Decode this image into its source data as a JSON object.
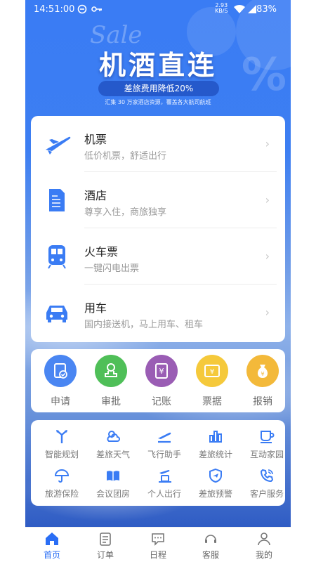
{
  "status_bar": {
    "time": "14:51:00",
    "net_speed_value": "2.93",
    "net_speed_unit": "KB/S",
    "battery": "83%"
  },
  "banner": {
    "sale_word": "Sale",
    "title": "机酒直连",
    "pill": "差旅费用降低20%",
    "subtitle": "汇集 30 万家酒店资源，覆盖各大航司航班",
    "percent_glyph": "%"
  },
  "services": [
    {
      "title": "机票",
      "desc": "低价机票，舒适出行",
      "icon": "airplane-icon"
    },
    {
      "title": "酒店",
      "desc": "尊享入住，商旅独享",
      "icon": "hotel-icon"
    },
    {
      "title": "火车票",
      "desc": "一键闪电出票",
      "icon": "train-icon"
    },
    {
      "title": "用车",
      "desc": "国内接送机，马上用车、租车",
      "icon": "car-icon"
    }
  ],
  "tools": [
    {
      "label": "申请",
      "color": "#4a86f2",
      "icon": "application-icon"
    },
    {
      "label": "审批",
      "color": "#4fbf58",
      "icon": "approval-icon"
    },
    {
      "label": "记账",
      "color": "#9a5db4",
      "icon": "bookkeeping-icon"
    },
    {
      "label": "票据",
      "color": "#f5c93b",
      "icon": "receipt-icon"
    },
    {
      "label": "报销",
      "color": "#f3b93a",
      "icon": "reimbursement-icon"
    }
  ],
  "grid": [
    {
      "label": "智能规划",
      "icon": "route-icon"
    },
    {
      "label": "差旅天气",
      "icon": "weather-icon"
    },
    {
      "label": "飞行助手",
      "icon": "takeoff-icon"
    },
    {
      "label": "差旅统计",
      "icon": "statistics-icon"
    },
    {
      "label": "互动家园",
      "icon": "cup-icon"
    },
    {
      "label": "旅游保险",
      "icon": "umbrella-icon"
    },
    {
      "label": "会议团房",
      "icon": "book-icon"
    },
    {
      "label": "个人出行",
      "icon": "traveler-icon"
    },
    {
      "label": "差旅预警",
      "icon": "shield-plane-icon"
    },
    {
      "label": "客户服务",
      "icon": "phone-icon"
    }
  ],
  "tabs": [
    {
      "label": "首页",
      "icon": "home-icon",
      "active": true
    },
    {
      "label": "订单",
      "icon": "order-icon",
      "active": false
    },
    {
      "label": "日程",
      "icon": "schedule-icon",
      "active": false
    },
    {
      "label": "客服",
      "icon": "headset-icon",
      "active": false
    },
    {
      "label": "我的",
      "icon": "profile-icon",
      "active": false
    }
  ],
  "colors": {
    "accent": "#2a6ef5",
    "icon_blue": "#3a7cf4",
    "banner_top": "#3a7cf4"
  }
}
